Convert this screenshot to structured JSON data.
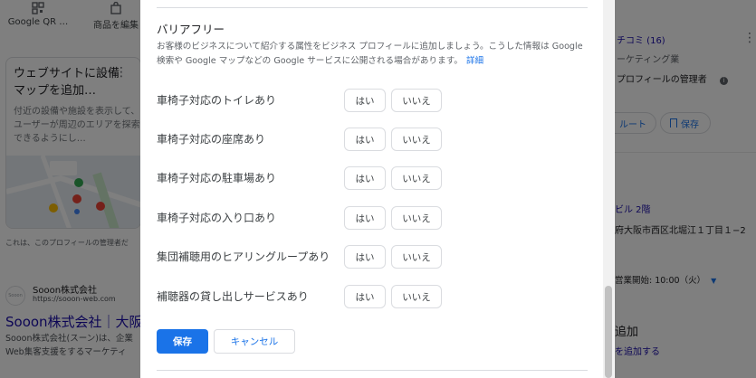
{
  "background": {
    "top_actions": [
      {
        "label": "Google QR …",
        "icon": "qr-code-icon"
      },
      {
        "label": "商品を編集",
        "icon": "shopping-bag-icon"
      }
    ],
    "card": {
      "title": "ウェブサイトに設備マップを追加…",
      "description": "付近の設備や施設を表示して、ユーザーが周辺のエリアを探索できるようにし…"
    },
    "note": "これは、このプロフィールの管理者だ",
    "result": {
      "favicon_text": "Sooon",
      "site_name": "Sooon株式会社",
      "url": "https://sooon-web.com",
      "title": "Sooon株式会社｜大阪",
      "snippet_1": "Sooon株式会社(スーン)は、企業",
      "snippet_2": "Web集客支援をするマーケティ"
    },
    "right_panel": {
      "kuchikomi": "チコミ (16)",
      "category": "ーケティング業",
      "owner": "プロフィールの管理者",
      "route_label": "ルート",
      "save_label": "保存",
      "floor": "ビル 2階",
      "address": "府大阪市西区北堀江１丁目１−2",
      "hours": "営業開始: 10:00（火）",
      "add_title": "追加",
      "add_link": "を追加する"
    }
  },
  "dialog": {
    "section_title": "バリアフリー",
    "description": "お客様のビジネスについて紹介する属性をビジネス プロフィールに追加しましょう。こうした情報は Google 検索や Google マップなどの Google サービスに公開される場合があります。",
    "details_link": "詳細",
    "yes_label": "はい",
    "no_label": "いいえ",
    "attributes": [
      "車椅子対応のトイレあり",
      "車椅子対応の座席あり",
      "車椅子対応の駐車場あり",
      "車椅子対応の入り口あり",
      "集団補聴用のヒアリングループあり",
      "補聴器の貸し出しサービスあり"
    ],
    "save_button": "保存",
    "cancel_button": "キャンセル"
  },
  "colors": {
    "accent": "#1a73e8",
    "link": "#1a0dab",
    "overlay": "rgba(0,0,0,0.5)"
  }
}
